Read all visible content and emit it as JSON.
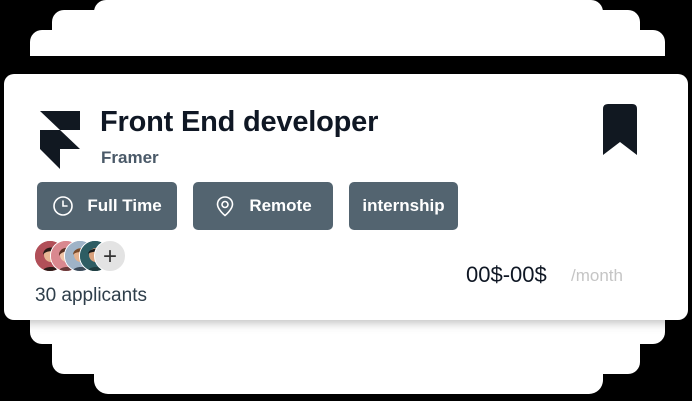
{
  "job": {
    "title": "Front End developer",
    "company": "Framer",
    "logo_icon": "framer-logo",
    "bookmark_icon": "bookmark-icon"
  },
  "tags": [
    {
      "label": "Full Time",
      "icon": "clock-icon"
    },
    {
      "label": "Remote",
      "icon": "location-pin-icon"
    },
    {
      "label": "internship"
    }
  ],
  "applicants": {
    "count_text": "30 applicants",
    "more_symbol": "+"
  },
  "salary": {
    "amount": "00$-00$",
    "period": "/month"
  },
  "colors": {
    "tag_background": "#536470",
    "title": "#0f1724",
    "company": "#4a5968",
    "period": "#c5c5c5"
  }
}
